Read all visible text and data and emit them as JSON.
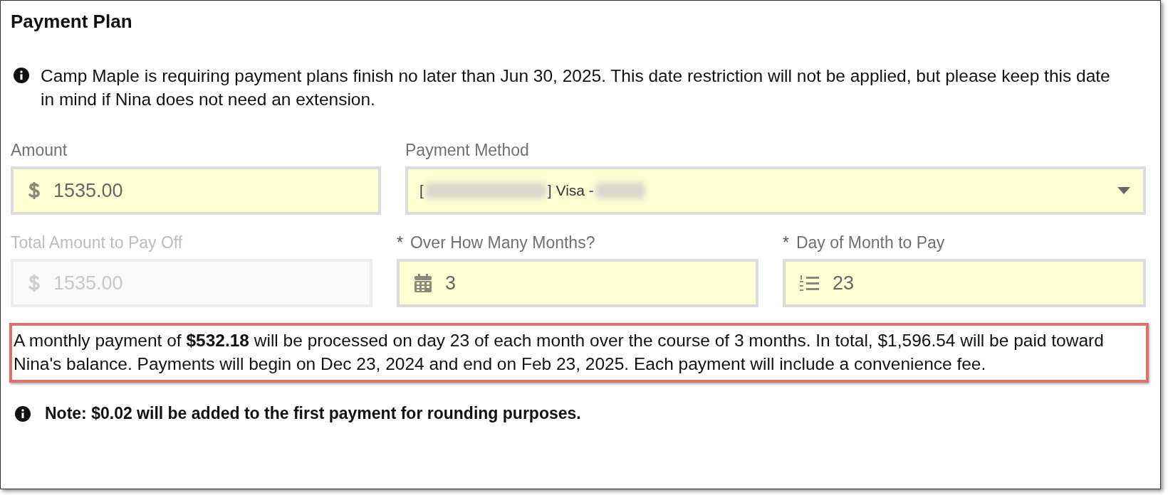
{
  "title": "Payment Plan",
  "info": "Camp Maple is requiring payment plans finish no later than Jun 30, 2025. This date restriction will not be applied, but please keep this date in mind if Nina does not need an extension.",
  "fields": [
    {
      "kind": "money",
      "label": "Amount",
      "disabled": false,
      "value": "1535.00"
    },
    {
      "kind": "select",
      "label": "Payment Method",
      "disabled": false,
      "parts": [
        {
          "kind": "text",
          "text": "["
        },
        {
          "kind": "redacted"
        },
        {
          "kind": "text",
          "text": "] Visa -"
        },
        {
          "kind": "redacted"
        }
      ]
    },
    {
      "kind": "money",
      "label": "Total Amount to Pay Off",
      "disabled": true,
      "value": "1535.00"
    },
    {
      "kind": "calendar",
      "label": "Over How Many Months?",
      "required_mark": "*",
      "disabled": false,
      "value": "3"
    },
    {
      "kind": "list",
      "label": "Day of Month to Pay",
      "required_mark": "*",
      "disabled": false,
      "value": "23"
    }
  ],
  "summary": "A monthly payment of **$532.18** will be processed on day 23 of each month over the course of 3 months. In total, $1,596.54 will be paid toward Nina's balance. Payments will begin on Dec 23, 2024 and end on Feb 23, 2025. Each payment will include a convenience fee.",
  "note": "Note: $0.02 will be added to the first payment for rounding purposes."
}
